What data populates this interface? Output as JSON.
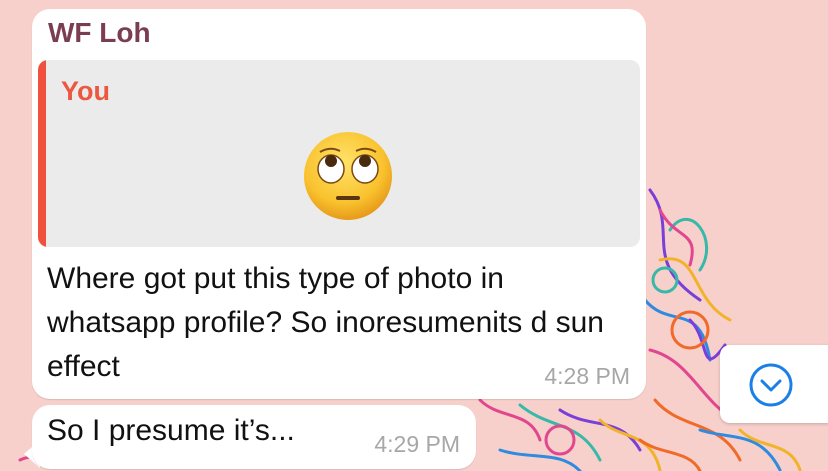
{
  "chat": {
    "sender_name": "WF Loh",
    "quote": {
      "author": "You",
      "emoji": "face-with-rolling-eyes"
    },
    "message_text": "Where got put this type of photo in whatsapp profile? So inoresumenits d sun effect",
    "message_time": "4:28 PM",
    "second_message_text": "So I presume it’s...",
    "second_message_time": "4:29 PM"
  },
  "scroll_button": {
    "icon": "chevron-down-circle-icon"
  },
  "colors": {
    "background": "#f8d0cb",
    "sender_name": "#7b3d52",
    "quote_accent": "#f0513f",
    "timestamp": "#a7a7a7",
    "scroll_icon": "#1a7fe6"
  }
}
